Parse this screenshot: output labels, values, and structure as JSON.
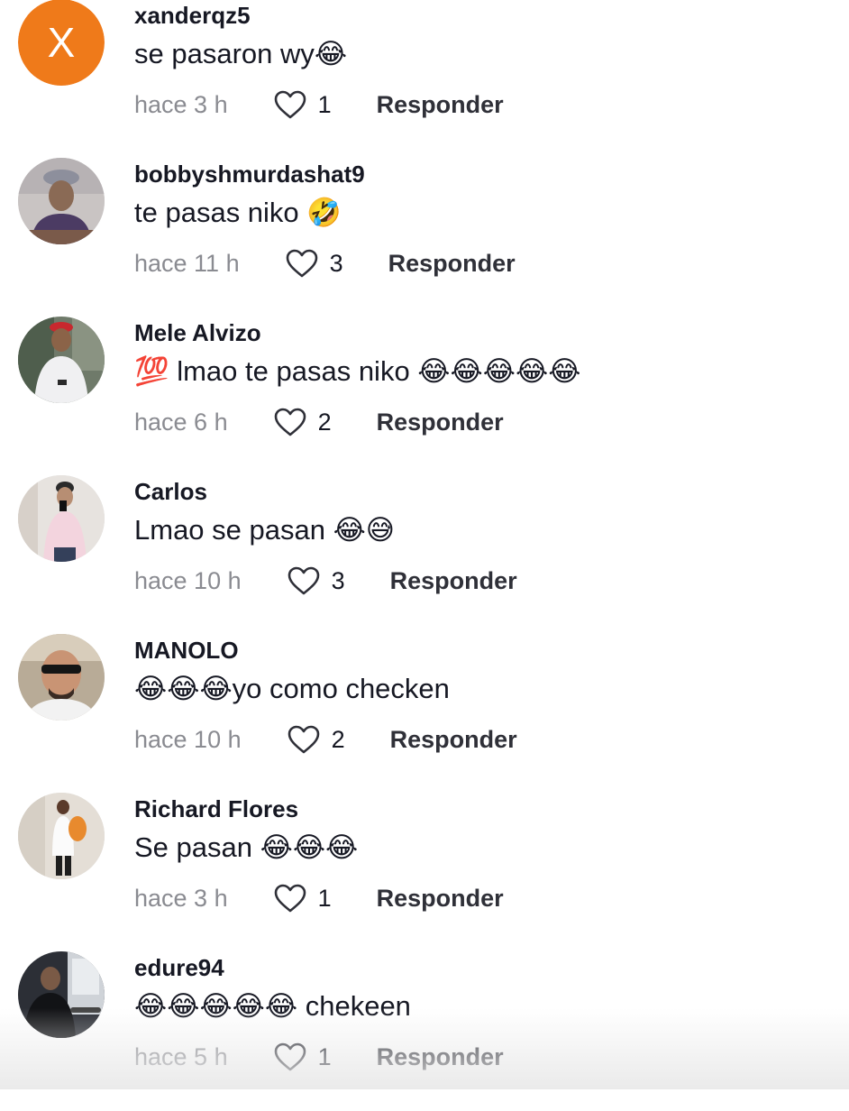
{
  "comments": [
    {
      "username": "xanderqz5",
      "text": "se pasaron wy😂",
      "time": "hace 3 h",
      "likes": "1",
      "reply_label": "Responder",
      "avatar_letter": "X",
      "avatar_color": "#ef7a1a"
    },
    {
      "username": "bobbyshmurdashat9",
      "text": "te pasas niko 🤣",
      "time": "hace 11 h",
      "likes": "3",
      "reply_label": "Responder"
    },
    {
      "username": "Mele Alvizo",
      "text": "💯 lmao te pasas niko 😂😂😂😂😂",
      "time": "hace 6 h",
      "likes": "2",
      "reply_label": "Responder"
    },
    {
      "username": "Carlos",
      "text": "Lmao se pasan 😂😅",
      "time": "hace 10 h",
      "likes": "3",
      "reply_label": "Responder"
    },
    {
      "username": "MANOLO",
      "text": "😂😂😂yo como checken",
      "time": "hace 10 h",
      "likes": "2",
      "reply_label": "Responder"
    },
    {
      "username": "Richard Flores",
      "text": "Se pasan 😂😂😂",
      "time": "hace 3 h",
      "likes": "1",
      "reply_label": "Responder"
    },
    {
      "username": "edure94",
      "text": "😂😂😂😂😂 chekeen",
      "time": "hace 5 h",
      "likes": "1",
      "reply_label": "Responder"
    }
  ],
  "icons": {
    "like": "heart-outline-icon"
  },
  "colors": {
    "text_primary": "#161823",
    "text_secondary": "#8a8b91",
    "avatar_orange": "#ef7a1a"
  }
}
